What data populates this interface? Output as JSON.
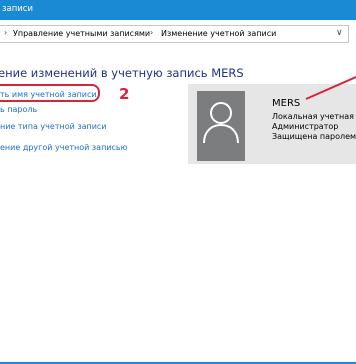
{
  "window": {
    "title": "записи"
  },
  "address_bar": {
    "breadcrumb_1": "Управление учетными записями",
    "breadcrumb_2": "Изменение учетной записи",
    "separator": "›",
    "dropdown_glyph": "∨"
  },
  "main": {
    "heading": "ение изменений в учетную запись MERS",
    "links": {
      "rename": "ть имя учетной записи",
      "password": "ь пароль",
      "change_type": "ние типа учетной записи",
      "manage_other": "ение другой учетной записью"
    }
  },
  "account": {
    "name": "MERS",
    "type": "Локальная учетная за",
    "role": "Администратор",
    "protection": "Защищена паролем",
    "avatar_icon": "user-icon"
  },
  "annotations": {
    "step_number": "2",
    "color": "#d8243a"
  },
  "colors": {
    "titlebar": "#1a8ad4",
    "heading": "#1e3287",
    "link": "#1c6fc4",
    "card_bg": "#e6e6e6",
    "avatar_bg": "#7b7d7e"
  }
}
